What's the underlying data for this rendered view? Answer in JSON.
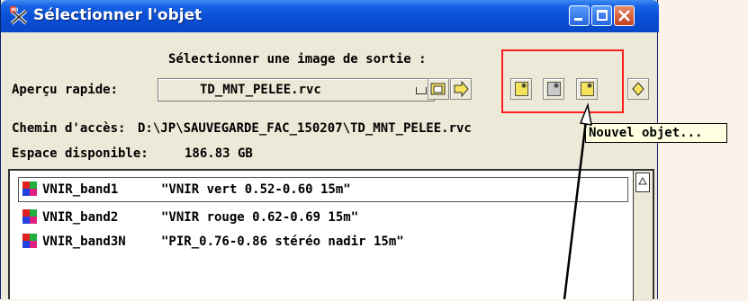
{
  "window": {
    "title": "Sélectionner l'objet"
  },
  "header": {
    "prompt": "Sélectionner une image de sortie :"
  },
  "quick_view": {
    "label": "Aperçu rapide:",
    "value": "TD_MNT_PELEE.rvc"
  },
  "path": {
    "label": "Chemin d'accès:",
    "value": "D:\\JP\\SAUVEGARDE_FAC_150207\\TD_MNT_PELEE.rvc"
  },
  "space": {
    "label": "Espace disponible:",
    "value": "186.83 GB"
  },
  "tooltip": {
    "text": "Nouvel objet..."
  },
  "list": {
    "items": [
      {
        "name": "VNIR_band1",
        "desc": "\"VNIR vert 0.52-0.60  15m\""
      },
      {
        "name": "VNIR_band2",
        "desc": "\"VNIR rouge 0.62-0.69  15m\""
      },
      {
        "name": "VNIR_band3N",
        "desc": "\"PIR_0.76-0.86 stéréo nadir  15m\""
      }
    ]
  },
  "colors": {
    "highlight": "#ff1e1e",
    "titlebar": "#0a4fd6"
  }
}
